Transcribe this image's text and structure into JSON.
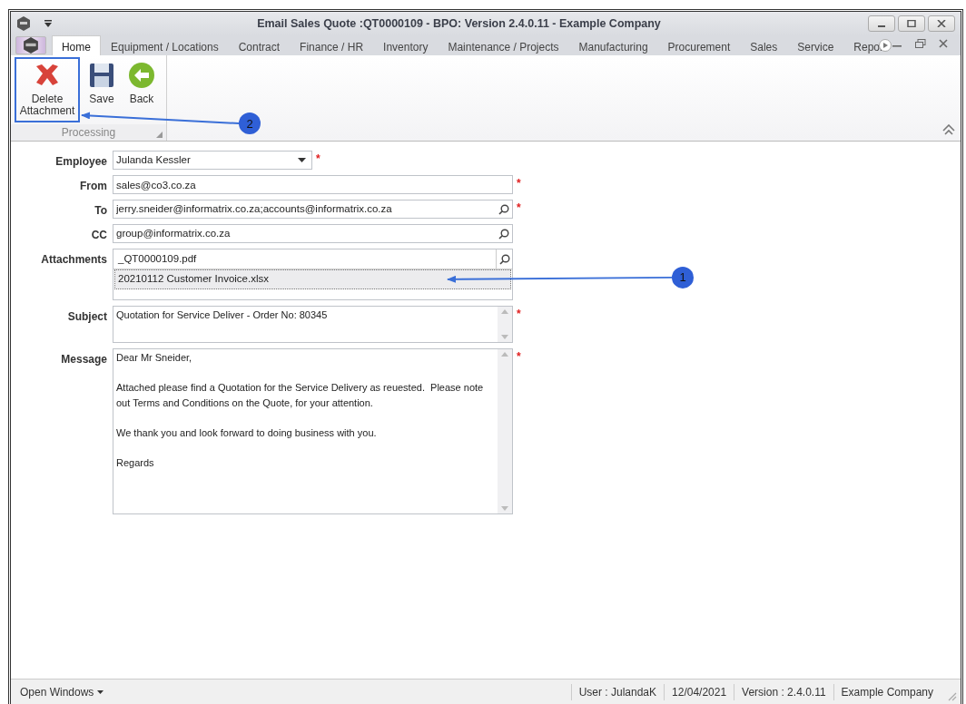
{
  "window": {
    "title": "Email Sales Quote :QT0000109 - BPO: Version 2.4.0.11 - Example Company"
  },
  "ribbon_tabs": [
    {
      "label": "Home",
      "selected": true
    },
    {
      "label": "Equipment / Locations",
      "selected": false
    },
    {
      "label": "Contract",
      "selected": false
    },
    {
      "label": "Finance / HR",
      "selected": false
    },
    {
      "label": "Inventory",
      "selected": false
    },
    {
      "label": "Maintenance / Projects",
      "selected": false
    },
    {
      "label": "Manufacturing",
      "selected": false
    },
    {
      "label": "Procurement",
      "selected": false
    },
    {
      "label": "Sales",
      "selected": false
    },
    {
      "label": "Service",
      "selected": false
    },
    {
      "label": "Repor",
      "selected": false
    }
  ],
  "ribbon": {
    "group": "Processing",
    "buttons": [
      {
        "label": "Delete Attachment",
        "kind": "delete",
        "highlighted": true
      },
      {
        "label": "Save",
        "kind": "save",
        "highlighted": false
      },
      {
        "label": "Back",
        "kind": "back",
        "highlighted": false
      }
    ]
  },
  "form": {
    "required_mark": "*",
    "fields": [
      {
        "label": "Employee",
        "kind": "dropdown",
        "value": "Julanda Kessler",
        "required": true
      },
      {
        "label": "From",
        "kind": "text",
        "value": "sales@co3.co.za",
        "required": true
      },
      {
        "label": "To",
        "kind": "lookup",
        "value": "jerry.sneider@informatrix.co.za;accounts@informatrix.co.za",
        "required": true
      },
      {
        "label": "CC",
        "kind": "lookup",
        "value": "group@informatrix.co.za",
        "required": false
      },
      {
        "label": "Attachments",
        "kind": "list",
        "items": [
          {
            "name": "_QT0000109.pdf",
            "selected": false
          },
          {
            "name": "20210112 Customer Invoice.xlsx",
            "selected": true
          }
        ],
        "required": false
      },
      {
        "label": "Subject",
        "kind": "memo",
        "paragraphs": [
          "Quotation for Service Deliver - Order No: 80345"
        ],
        "required": true
      },
      {
        "label": "Message",
        "kind": "memo",
        "paragraphs": [
          "Dear Mr Sneider,",
          "Attached please find a Quotation for the Service Delivery as reuested.  Please note out Terms and Conditions on the Quote, for your attention.",
          "We thank you and look forward to doing business with you.",
          "Regards"
        ],
        "required": true
      }
    ]
  },
  "callouts": [
    {
      "number": "1"
    },
    {
      "number": "2"
    }
  ],
  "status_bar": {
    "menu": "Open Windows",
    "items": [
      "User : JulandaK",
      "12/04/2021",
      "Version : 2.4.0.11",
      "Example Company"
    ]
  }
}
